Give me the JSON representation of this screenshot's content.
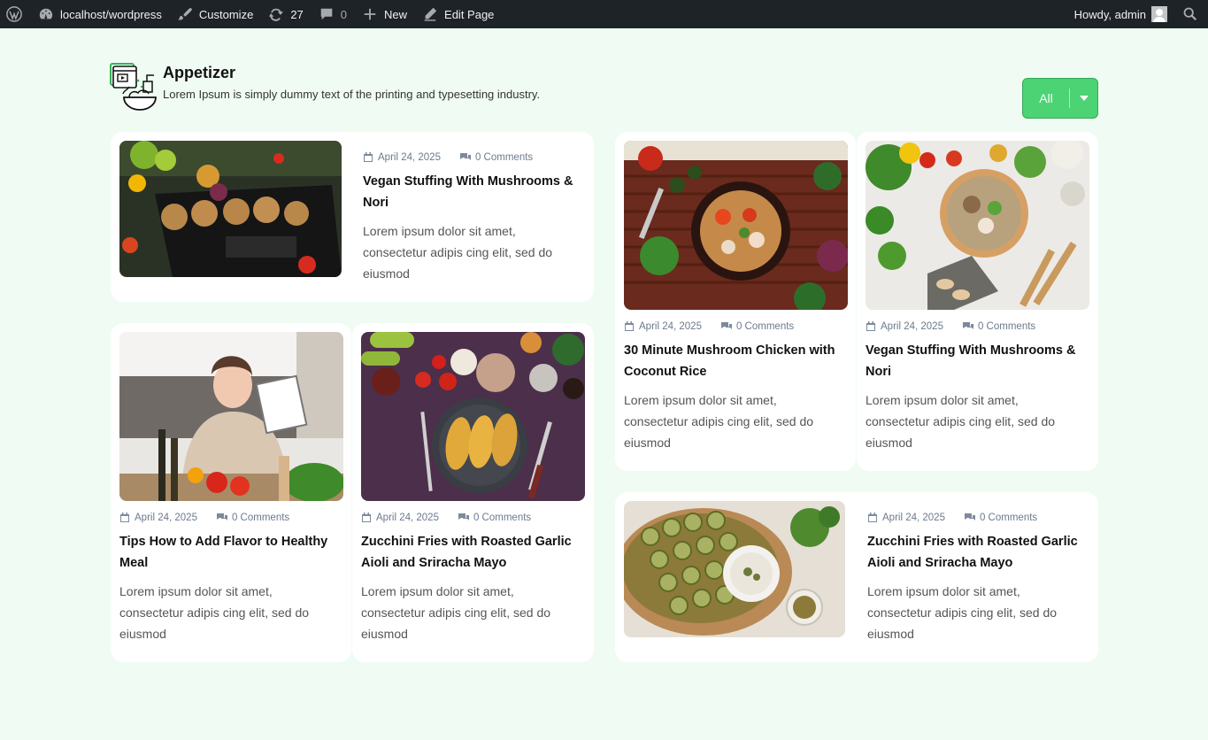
{
  "adminbar": {
    "site": "localhost/wordpress",
    "customize": "Customize",
    "updates": "27",
    "comments": "0",
    "new": "New",
    "edit": "Edit Page",
    "howdy": "Howdy, admin"
  },
  "section": {
    "title": "Appetizer",
    "subtitle": "Lorem Ipsum is simply dummy text of the printing and typesetting industry."
  },
  "filter": {
    "label": "All"
  },
  "posts": [
    {
      "date": "April 24, 2025",
      "comments": "0 Comments",
      "title_l1": "Vegan Stuffing With Mushrooms &",
      "title_l2": "Nori",
      "ex1": "Lorem ipsum dolor sit amet,",
      "ex2": "consectetur adipis cing elit, sed do",
      "ex3": "eiusmod"
    },
    {
      "date": "April 24, 2025",
      "comments": "0 Comments",
      "title_l1": "Tips How to Add Flavor to Healthy",
      "title_l2": "Meal",
      "ex1": "Lorem ipsum dolor sit amet,",
      "ex2": "consectetur adipis cing elit, sed do",
      "ex3": "eiusmod"
    },
    {
      "date": "April 24, 2025",
      "comments": "0 Comments",
      "title_l1": "Zucchini Fries with Roasted Garlic",
      "title_l2": "Aioli and Sriracha Mayo",
      "ex1": "Lorem ipsum dolor sit amet,",
      "ex2": "consectetur adipis cing elit, sed do",
      "ex3": "eiusmod"
    },
    {
      "date": "April 24, 2025",
      "comments": "0 Comments",
      "title_l1": "30 Minute Mushroom Chicken with",
      "title_l2": "Coconut Rice",
      "ex1": "Lorem ipsum dolor sit amet,",
      "ex2": "consectetur adipis cing elit, sed do",
      "ex3": "eiusmod"
    },
    {
      "date": "April 24, 2025",
      "comments": "0 Comments",
      "title_l1": "Vegan Stuffing With Mushrooms &",
      "title_l2": "Nori",
      "ex1": "Lorem ipsum dolor sit amet,",
      "ex2": "consectetur adipis cing elit, sed do",
      "ex3": "eiusmod"
    },
    {
      "date": "April 24, 2025",
      "comments": "0 Comments",
      "title_l1": "Zucchini Fries with Roasted Garlic",
      "title_l2": "Aioli and Sriracha Mayo",
      "ex1": "Lorem ipsum dolor sit amet,",
      "ex2": "consectetur adipis cing elit, sed do",
      "ex3": "eiusmod"
    }
  ]
}
